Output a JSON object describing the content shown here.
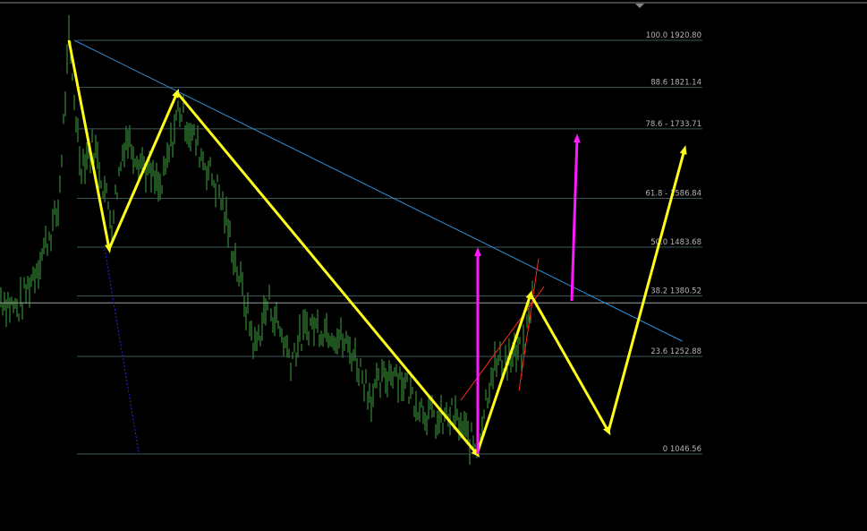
{
  "colors": {
    "background": "#000000",
    "candles": "#3fa33f",
    "fib_lines": "#3a5a5a",
    "trendline": "#2f8fd8",
    "wave": "#ffff1a",
    "target_arrows": "#ff19ff",
    "hline": "#9aa0a0",
    "dotted": "#2a2ad8",
    "red": "#ff2a1a"
  },
  "chart_data": {
    "type": "line",
    "title": "",
    "xlabel": "",
    "ylabel": "",
    "y_range": [
      930,
      2000
    ],
    "grid": false,
    "fib_levels": [
      {
        "ratio": "100.0",
        "price": 1920.8,
        "label": "100.0 1920.80"
      },
      {
        "ratio": "88.6",
        "price": 1821.14,
        "label": "88.6 1821.14"
      },
      {
        "ratio": "78.6",
        "price": 1733.71,
        "label": "78.6 - 1733.71"
      },
      {
        "ratio": "61.8",
        "price": 1586.84,
        "label": "61.8 - 1586.84"
      },
      {
        "ratio": "50.0",
        "price": 1483.68,
        "label": "50.0 1483.68"
      },
      {
        "ratio": "38.2",
        "price": 1380.52,
        "label": "38.2 1380.52"
      },
      {
        "ratio": "23.6",
        "price": 1252.88,
        "label": "23.6 1252.88"
      },
      {
        "ratio": "0",
        "price": 1046.56,
        "label": "0 1046.56"
      }
    ],
    "horizontal_line_price": 1366,
    "wave_path": [
      {
        "t": 0.0,
        "price": 1920.8
      },
      {
        "t": 0.1,
        "price": 1480
      },
      {
        "t": 0.27,
        "price": 1810
      },
      {
        "t": 1.0,
        "price": 1046.56
      },
      {
        "t": 1.13,
        "price": 1384
      },
      {
        "t": 1.32,
        "price": 1094
      },
      {
        "t": 1.52,
        "price": 1690
      }
    ],
    "trendline": [
      {
        "t": 0.0,
        "price": 1920.8
      },
      {
        "t": 1.35,
        "price": 1285
      }
    ],
    "target_arrows": [
      {
        "t_start": 1.0,
        "price_start": 1046.56,
        "price_end": 1474
      },
      {
        "t_start": 1.22,
        "price_start": 1370,
        "price_end": 1714
      }
    ]
  }
}
